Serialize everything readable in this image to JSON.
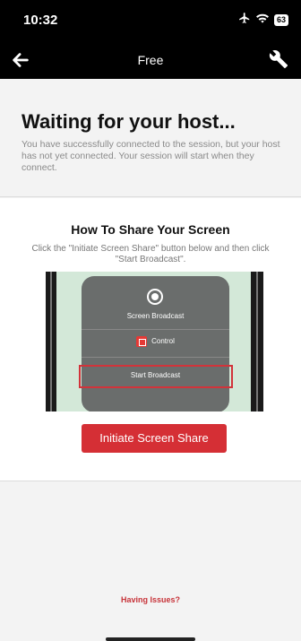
{
  "status_bar": {
    "time": "10:32",
    "battery": "63",
    "icons": [
      "airplane-icon",
      "wifi-icon",
      "battery-icon"
    ]
  },
  "nav": {
    "title": "Free",
    "back_icon": "back-arrow-icon",
    "tools_icon": "wrench-icon"
  },
  "waiting": {
    "title": "Waiting for your host...",
    "description": "You have successfully connected to the session, but your host has not yet connected. Your session will start when they connect."
  },
  "share": {
    "title": "How To Share Your Screen",
    "description": "Click the \"Initiate Screen Share\" button below and then click \"Start Broadcast\".",
    "illustration": {
      "broadcast_label": "Screen Broadcast",
      "control_label": "Control",
      "start_label": "Start Broadcast"
    },
    "button_label": "Initiate Screen Share"
  },
  "footer": {
    "help_link": "Having Issues?"
  },
  "colors": {
    "accent": "#d52f35",
    "header_bg": "#000000",
    "page_bg": "#f3f3f3"
  }
}
